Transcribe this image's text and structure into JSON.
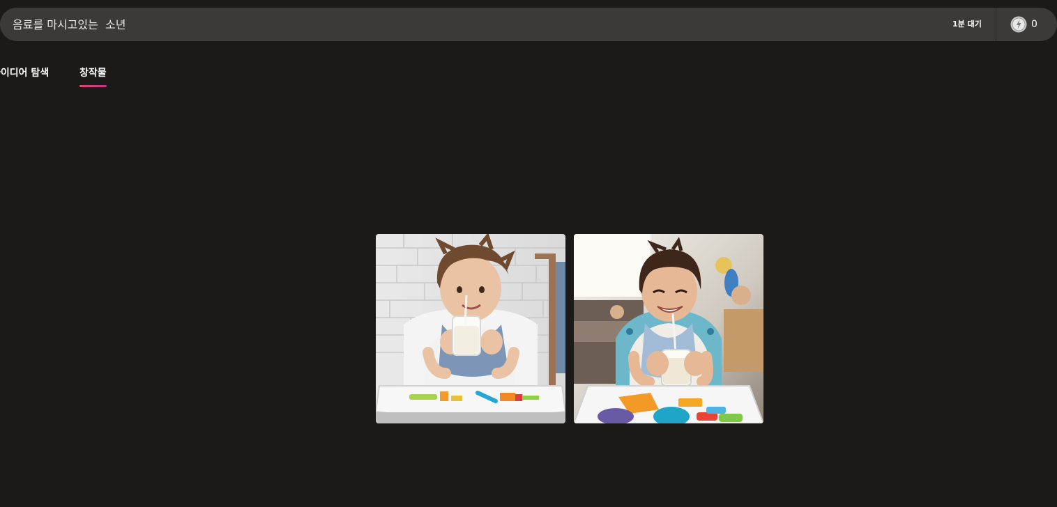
{
  "prompt": {
    "text": "음료를 마시고있는  소년"
  },
  "status": {
    "wait_label": "1분 대기",
    "coin_count": "0",
    "coin_icon": "coin-icon"
  },
  "tabs": [
    {
      "label": "아이디어 탐색",
      "active": false
    },
    {
      "label": "창작물",
      "active": true
    }
  ],
  "gallery": {
    "images": [
      {
        "subject": "toddler-drinking-milk-white-brick"
      },
      {
        "subject": "boy-drinking-milk-toys-room"
      }
    ]
  },
  "colors": {
    "background": "#1b1a19",
    "bar": "#3b3a39",
    "accent": "#e0457b"
  }
}
